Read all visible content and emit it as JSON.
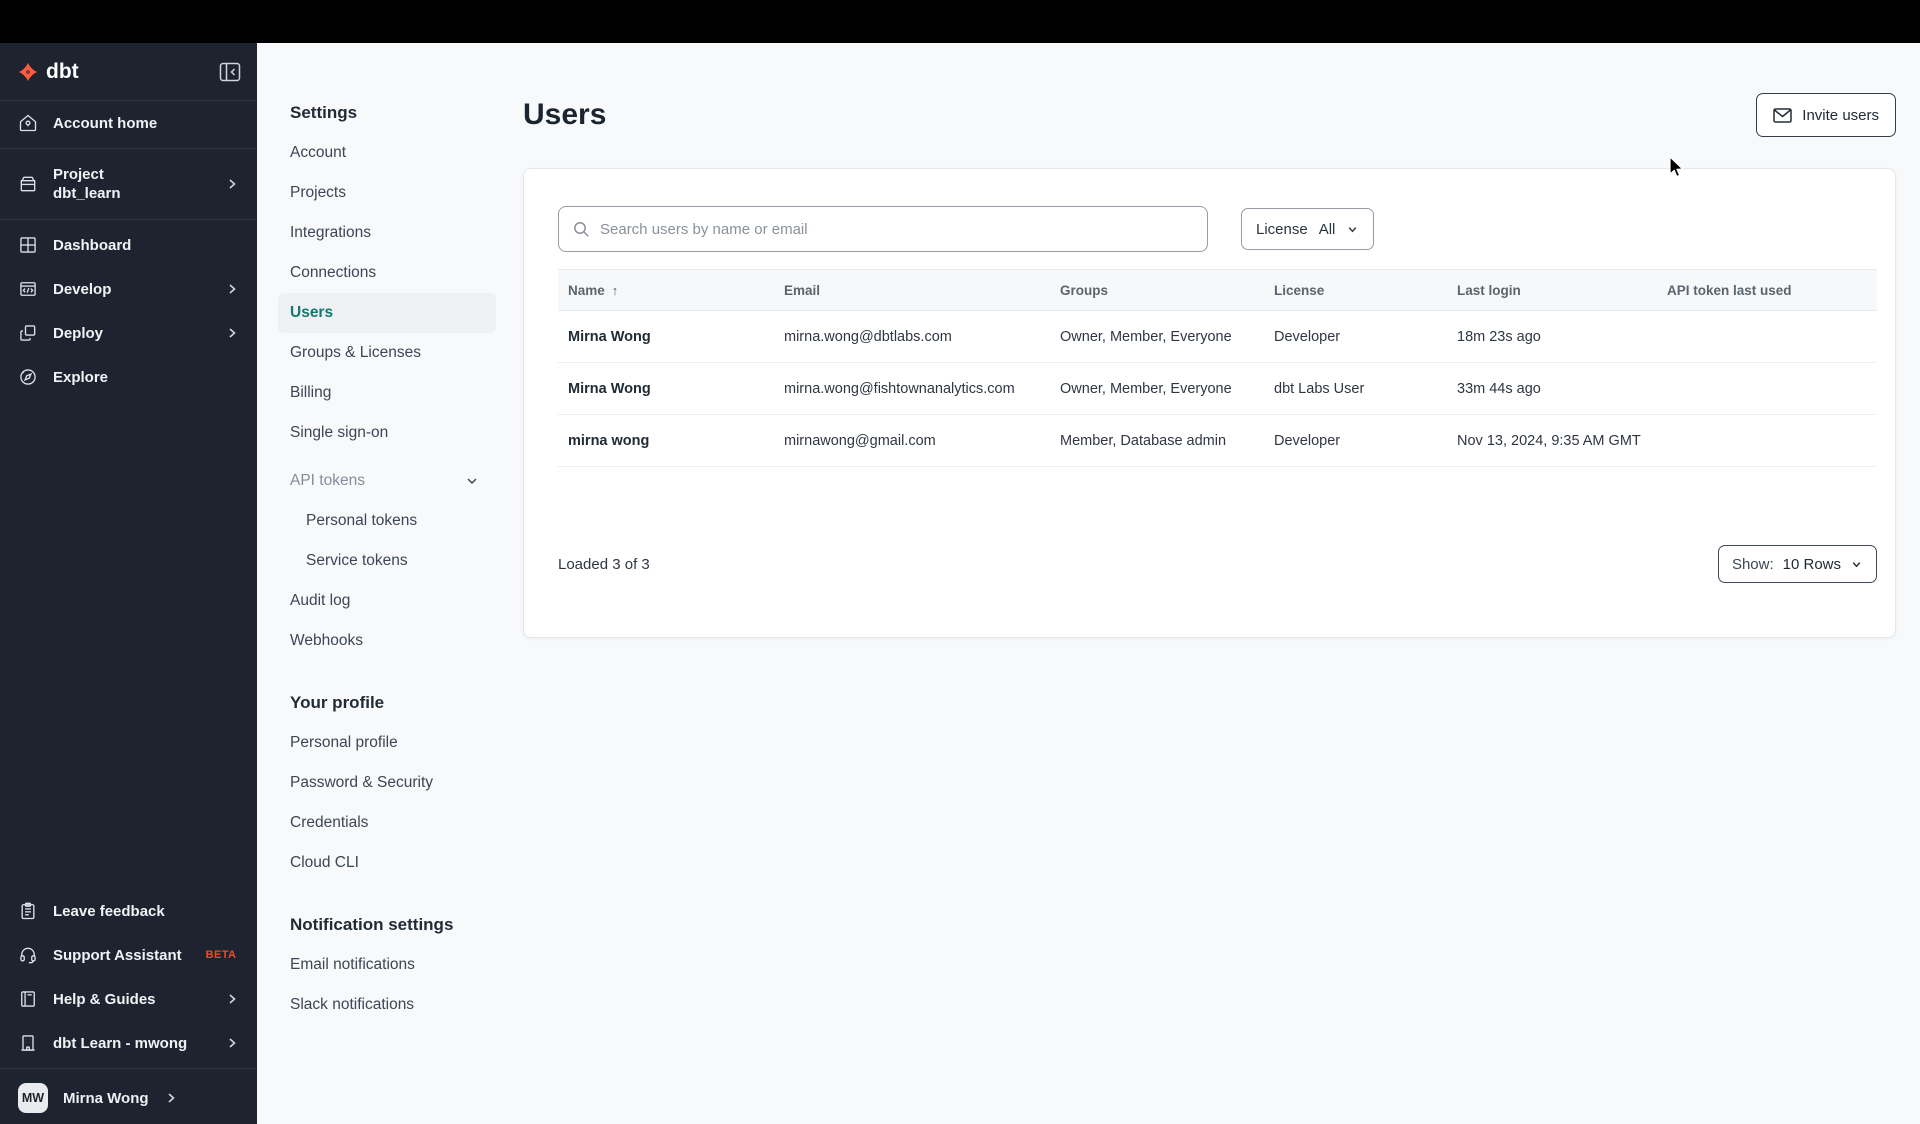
{
  "colors": {
    "accent_orange": "#ff5c3f",
    "beta_orange": "#ec4a27",
    "accent_teal": "#13786e",
    "sidebar_bg": "#1d242f"
  },
  "sidebar": {
    "brand": "dbt",
    "account_home": "Account home",
    "project_label": "Project",
    "project_name": "dbt_learn",
    "dashboard": "Dashboard",
    "develop": "Develop",
    "deploy": "Deploy",
    "explore": "Explore",
    "leave_feedback": "Leave feedback",
    "support_assistant": "Support Assistant",
    "support_badge": "BETA",
    "help_guides": "Help & Guides",
    "org_switcher": "dbt Learn - mwong",
    "user_initials": "MW",
    "user_name": "Mirna Wong"
  },
  "settings_nav": {
    "title": "Settings",
    "account": "Account",
    "projects": "Projects",
    "integrations": "Integrations",
    "connections": "Connections",
    "users": "Users",
    "groups_licenses": "Groups & Licenses",
    "billing": "Billing",
    "sso": "Single sign-on",
    "api_tokens": "API tokens",
    "personal_tokens": "Personal tokens",
    "service_tokens": "Service tokens",
    "audit_log": "Audit log",
    "webhooks": "Webhooks",
    "profile_title": "Your profile",
    "personal_profile": "Personal profile",
    "password_security": "Password & Security",
    "credentials": "Credentials",
    "cloud_cli": "Cloud CLI",
    "notifications_title": "Notification settings",
    "email_notifications": "Email notifications",
    "slack_notifications": "Slack notifications"
  },
  "main": {
    "title": "Users",
    "invite_button": "Invite users",
    "search": {
      "placeholder": "Search users by name or email"
    },
    "license_filter": {
      "label": "License",
      "value": "All"
    },
    "table": {
      "columns": [
        "Name",
        "Email",
        "Groups",
        "License",
        "Last login",
        "API token last used"
      ],
      "rows": [
        {
          "name": "Mirna Wong",
          "email": "mirna.wong@dbtlabs.com",
          "groups": "Owner, Member, Everyone",
          "license": "Developer",
          "last_login": "18m 23s ago",
          "api_token_last_used": ""
        },
        {
          "name": "Mirna Wong",
          "email": "mirna.wong@fishtownanalytics.com",
          "groups": "Owner, Member, Everyone",
          "license": "dbt Labs User",
          "last_login": "33m 44s ago",
          "api_token_last_used": ""
        },
        {
          "name": "mirna wong",
          "email": "mirnawong@gmail.com",
          "groups": "Member, Database admin",
          "license": "Developer",
          "last_login": "Nov 13, 2024, 9:35 AM GMT",
          "api_token_last_used": ""
        }
      ]
    },
    "footer": {
      "loaded_text": "Loaded 3 of 3",
      "show_label": "Show:",
      "show_value": "10 Rows"
    }
  }
}
